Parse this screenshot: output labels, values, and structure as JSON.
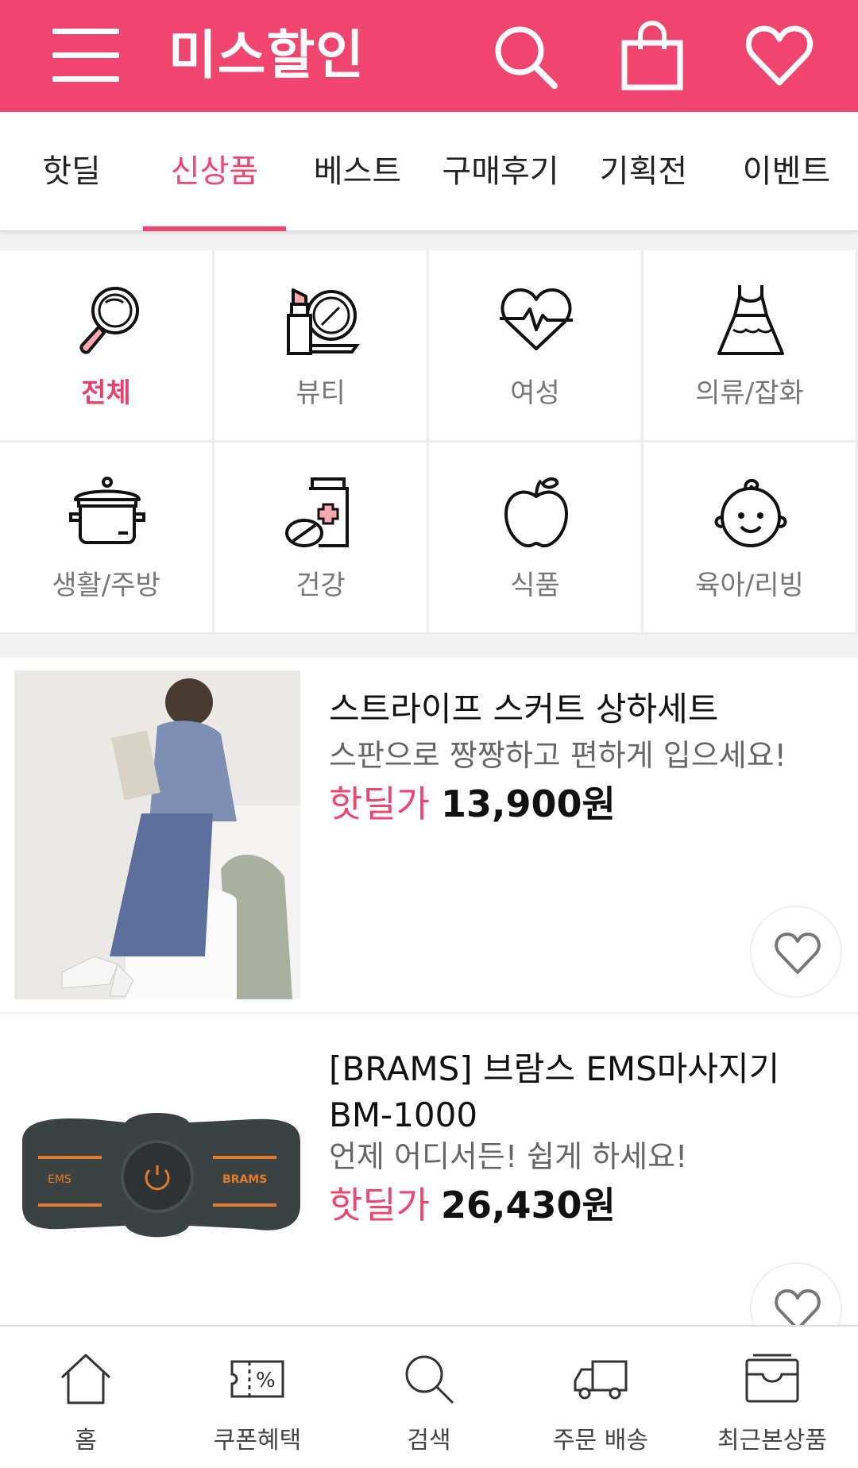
{
  "colors": {
    "brand": "#f0456f",
    "active_tab": "#f0456f",
    "price_label": "#f0456f"
  },
  "header": {
    "brand": "미스할인",
    "icons": [
      "menu-icon",
      "search-icon",
      "shopping-bag-icon",
      "heart-icon"
    ]
  },
  "tabs": [
    {
      "label": "핫딜",
      "active": false
    },
    {
      "label": "신상품",
      "active": true
    },
    {
      "label": "베스트",
      "active": false
    },
    {
      "label": "구매후기",
      "active": false
    },
    {
      "label": "기획전",
      "active": false
    },
    {
      "label": "이벤트",
      "active": false
    }
  ],
  "categories": [
    {
      "label": "전체",
      "icon": "magnifier-icon",
      "active": true
    },
    {
      "label": "뷰티",
      "icon": "lipstick-mirror-icon",
      "active": false
    },
    {
      "label": "여성",
      "icon": "heart-pulse-icon",
      "active": false
    },
    {
      "label": "의류/잡화",
      "icon": "dress-icon",
      "active": false
    },
    {
      "label": "생활/주방",
      "icon": "pot-icon",
      "active": false
    },
    {
      "label": "건강",
      "icon": "medicine-icon",
      "active": false
    },
    {
      "label": "식품",
      "icon": "apple-icon",
      "active": false
    },
    {
      "label": "육아/리빙",
      "icon": "baby-icon",
      "active": false
    }
  ],
  "products": [
    {
      "title": "스트라이프 스커트 상하세트",
      "subtitle": "스판으로 짱짱하고 편하게 입으세요!",
      "price_label": "핫딜가",
      "price": "13,900원"
    },
    {
      "title": "[BRAMS] 브람스 EMS마사지기 BM-1000",
      "subtitle": "언제 어디서든! 쉽게 하세요!",
      "price_label": "핫딜가",
      "price": "26,430원",
      "device_text_left": "EMS",
      "device_text_right": "BRAMS"
    }
  ],
  "bottom_nav": [
    {
      "label": "홈",
      "icon": "home-icon"
    },
    {
      "label": "쿠폰혜택",
      "icon": "coupon-icon"
    },
    {
      "label": "검색",
      "icon": "search-icon"
    },
    {
      "label": "주문 배송",
      "icon": "truck-icon"
    },
    {
      "label": "최근본상품",
      "icon": "recent-box-icon"
    }
  ]
}
